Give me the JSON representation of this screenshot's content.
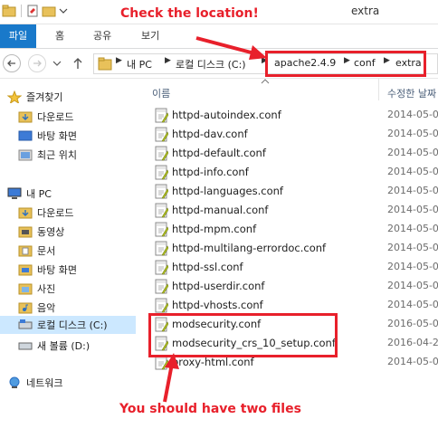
{
  "window": {
    "title": "extra"
  },
  "annotations": {
    "top_callout": "Check the location!",
    "bottom_callout": "You should have two files"
  },
  "ribbon": {
    "tabs": [
      "파일",
      "홈",
      "공유",
      "보기"
    ]
  },
  "address": {
    "crumbs": [
      "내 PC",
      "로컬 디스크 (C:)",
      "apache2.4.9",
      "conf",
      "extra"
    ]
  },
  "columns": {
    "name": "이름",
    "modified": "수정한 날짜"
  },
  "nav": {
    "favorites_label": "즐겨찾기",
    "favorites": [
      "다운로드",
      "바탕 화면",
      "최근 위치"
    ],
    "pc_label": "내 PC",
    "pc_items": [
      "다운로드",
      "동영상",
      "문서",
      "바탕 화면",
      "사진",
      "음악",
      "로컬 디스크 (C:)",
      "새 볼륨 (D:)"
    ],
    "network_label": "네트워크"
  },
  "files": [
    {
      "name": "httpd-autoindex.conf",
      "date": "2014-05-0"
    },
    {
      "name": "httpd-dav.conf",
      "date": "2014-05-0"
    },
    {
      "name": "httpd-default.conf",
      "date": "2014-05-0"
    },
    {
      "name": "httpd-info.conf",
      "date": "2014-05-0"
    },
    {
      "name": "httpd-languages.conf",
      "date": "2014-05-0"
    },
    {
      "name": "httpd-manual.conf",
      "date": "2014-05-0"
    },
    {
      "name": "httpd-mpm.conf",
      "date": "2014-05-0"
    },
    {
      "name": "httpd-multilang-errordoc.conf",
      "date": "2014-05-0"
    },
    {
      "name": "httpd-ssl.conf",
      "date": "2014-05-0"
    },
    {
      "name": "httpd-userdir.conf",
      "date": "2014-05-0"
    },
    {
      "name": "httpd-vhosts.conf",
      "date": "2014-05-0"
    },
    {
      "name": "modsecurity.conf",
      "date": "2016-05-0"
    },
    {
      "name": "modsecurity_crs_10_setup.conf",
      "date": "2016-04-2"
    },
    {
      "name": "proxy-html.conf",
      "date": "2014-05-0"
    }
  ],
  "colors": {
    "accent": "#1979ca",
    "annotation": "#e8202b",
    "selection": "#cce8ff"
  }
}
